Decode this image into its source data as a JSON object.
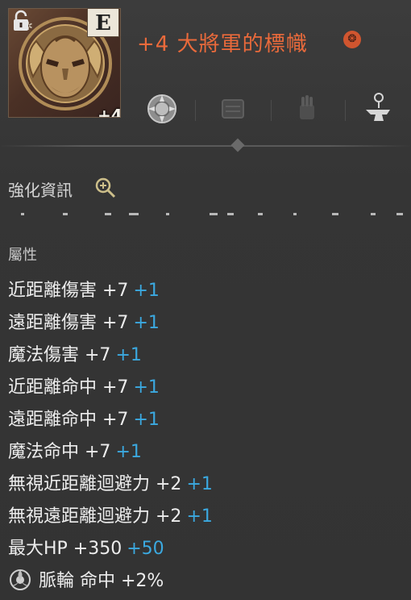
{
  "item": {
    "grade": "E",
    "enhance_level": "+4",
    "title": "+4 大將軍的標幟",
    "title_mark": "❂"
  },
  "enhance_info": {
    "label": "強化資訊"
  },
  "attributes": {
    "group_label": "屬性",
    "rows": [
      {
        "name": "近距離傷害 +7",
        "bonus": "+1"
      },
      {
        "name": "遠距離傷害 +7",
        "bonus": "+1"
      },
      {
        "name": "魔法傷害 +7",
        "bonus": "+1"
      },
      {
        "name": "近距離命中 +7",
        "bonus": "+1"
      },
      {
        "name": "遠距離命中 +7",
        "bonus": "+1"
      },
      {
        "name": "魔法命中 +7",
        "bonus": "+1"
      },
      {
        "name": "無視近距離迴避力 +2",
        "bonus": "+1"
      },
      {
        "name": "無視遠距離迴避力 +2",
        "bonus": "+1"
      },
      {
        "name": "最大HP +350",
        "bonus": "+50"
      }
    ],
    "pulse": "脈輪 命中 +2%"
  },
  "icons": [
    "settings-gear-icon",
    "lock-icon",
    "crystal-emblem-icon",
    "scroll-icon",
    "hand-rune-icon",
    "anvil-icon",
    "magnify-plus-icon",
    "pulse-wheel-icon"
  ],
  "colors": {
    "title": "#ea6a3b",
    "bonus": "#3ba9e0",
    "background": "#363636"
  }
}
